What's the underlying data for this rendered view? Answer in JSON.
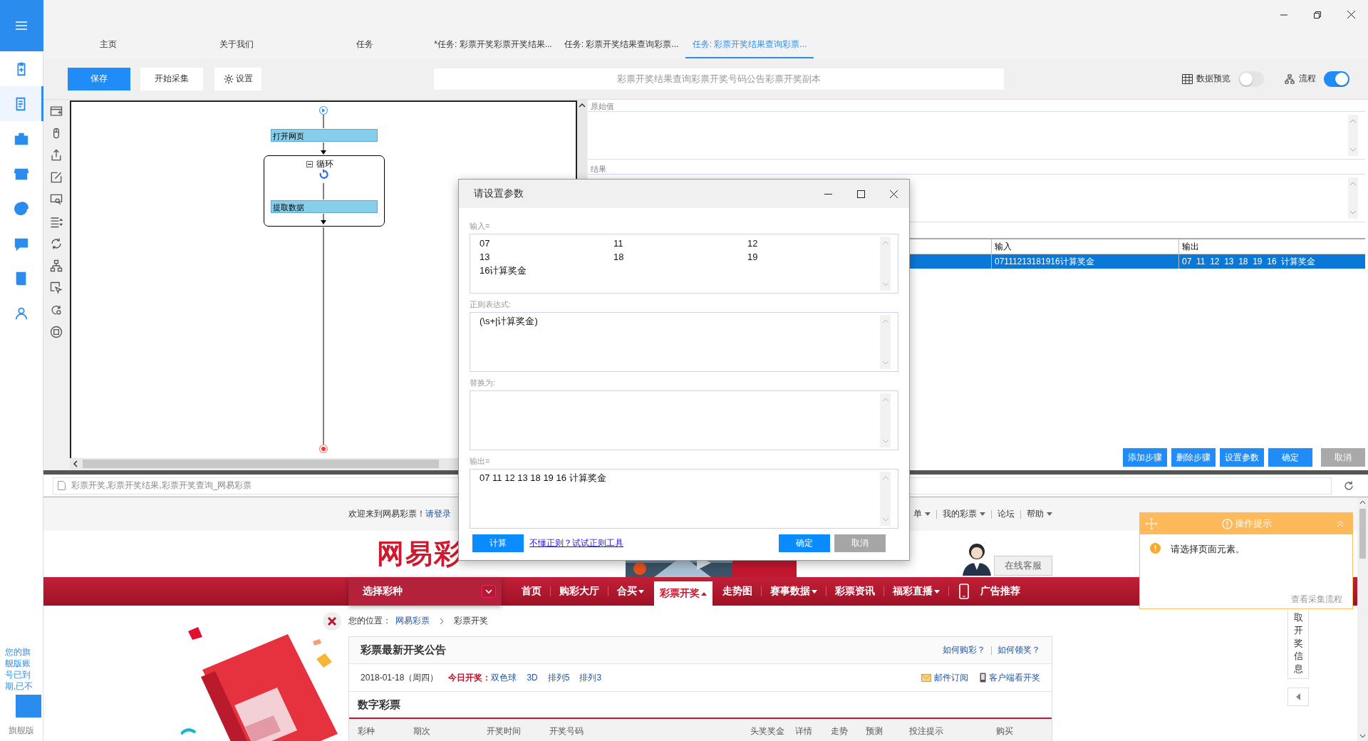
{
  "nav_icons": [
    {
      "selected": false
    },
    {
      "selected": true
    },
    {
      "selected": false
    },
    {
      "selected": false
    },
    {
      "selected": false
    },
    {
      "selected": false
    },
    {
      "selected": false
    },
    {
      "selected": false
    }
  ],
  "expiry_notice": "您的旗舰版账号已到期,已不",
  "edition_label": "旗舰版",
  "tabs": [
    {
      "label": "主页",
      "selected": false
    },
    {
      "label": "关于我们",
      "selected": false
    },
    {
      "label": "任务",
      "selected": false
    },
    {
      "label": "*任务: 彩票开奖彩票开奖结果...",
      "selected": false
    },
    {
      "label": "任务: 彩票开奖结果查询彩票...",
      "selected": false
    },
    {
      "label": "任务: 彩票开奖结果查询彩票...",
      "selected": true
    }
  ],
  "toolbar": {
    "save": "保存",
    "start": "开始采集",
    "settings": "设置",
    "task_name": "彩票开奖结果查询彩票开奖号码公告彩票开奖副本",
    "data_preview": {
      "label": "数据预览",
      "on": false
    },
    "flow": {
      "label": "流程",
      "on": true
    }
  },
  "flow": {
    "nodes": [
      {
        "label": "打开网页"
      }
    ],
    "loop": {
      "label": "循环",
      "expanded": true,
      "children": [
        {
          "label": "提取数据"
        }
      ]
    }
  },
  "right_panel": {
    "original_label": "原始值",
    "result_label": "结果",
    "table": {
      "columns": [
        "输入",
        "输出"
      ],
      "rows": [
        {
          "input": "07111213181916计算奖金",
          "output": "07  11  12  13  18  19  16  计算奖金",
          "selected": true
        }
      ]
    },
    "buttons": [
      {
        "label": "添加步骤",
        "kind": "primary"
      },
      {
        "label": "删除步骤",
        "kind": "primary"
      },
      {
        "label": "设置参数",
        "kind": "primary"
      },
      {
        "label": "确定",
        "kind": "primary"
      },
      {
        "label": "取消",
        "kind": "muted"
      }
    ]
  },
  "browser": {
    "address": "彩票开奖,彩票开奖结果,彩票开奖查询_网易彩票"
  },
  "webpage": {
    "topbar": {
      "welcome": "欢迎来到网易彩票！",
      "login": "请登录",
      "links": [
        {
          "label": "单",
          "dropdown": true
        },
        {
          "label": "我的彩票",
          "dropdown": true
        },
        {
          "label": "论坛",
          "dropdown": false
        },
        {
          "label": "帮助",
          "dropdown": true
        }
      ]
    },
    "logo": "网易彩",
    "service": "在线客服",
    "nav": {
      "selector": "选择彩种",
      "items": [
        {
          "label": "首页",
          "kind": "link",
          "dropdown": false,
          "selected": false
        },
        {
          "label": "购彩大厅",
          "kind": "link",
          "dropdown": false,
          "selected": false
        },
        {
          "label": "合买",
          "kind": "link",
          "dropdown": true,
          "selected": false
        },
        {
          "label": "彩票开奖",
          "kind": "link",
          "dropdown": true,
          "selected": true
        },
        {
          "label": "走势图",
          "kind": "link",
          "dropdown": false,
          "selected": false
        },
        {
          "label": "赛事数据",
          "kind": "link",
          "dropdown": true,
          "selected": false
        },
        {
          "label": "彩票资讯",
          "kind": "link",
          "dropdown": false,
          "selected": false
        },
        {
          "label": "福彩直播",
          "kind": "link",
          "dropdown": true,
          "selected": false
        },
        {
          "label": "广告推荐",
          "kind": "phone",
          "dropdown": false,
          "selected": false
        }
      ]
    },
    "breadcrumb": {
      "prefix": "您的位置：",
      "home": "网易彩票",
      "current": "彩票开奖"
    },
    "notice": {
      "title": "彩票最新开奖公告",
      "help_links": [
        "如何购彩？",
        "如何领奖？"
      ],
      "date": "2018-01-18（周四）",
      "today_label": "今日开奖：",
      "games": [
        "双色球",
        "3D",
        "排列5",
        "排列3"
      ],
      "subscribe": "邮件订阅",
      "client": "客户端看开奖",
      "section": "数字彩票",
      "columns": [
        "彩种",
        "期次",
        "开奖时间",
        "开奖号码",
        "头奖奖金",
        "详情",
        "走势",
        "预测",
        "投注提示",
        "购买"
      ]
    },
    "side_tab": "取开奖信息"
  },
  "dialog": {
    "title": "请设置参数",
    "fields": [
      {
        "label": "输入=",
        "cells": [
          "07",
          "11",
          "12",
          "13",
          "18",
          "19",
          "16计算奖金"
        ]
      },
      {
        "label": "正则表达式:",
        "value": "(\\s+|计算奖金)"
      },
      {
        "label": "替换为:"
      },
      {
        "label": "输出=",
        "value": "07 11 12 13 18 19 16 计算奖金"
      }
    ],
    "calc": "计算",
    "help_link": "不懂正则？试试正则工具",
    "ok": "确定",
    "cancel": "取消"
  },
  "hint": {
    "title": "操作提示",
    "message": "请选择页面元素。",
    "link": "查看采集流程"
  }
}
